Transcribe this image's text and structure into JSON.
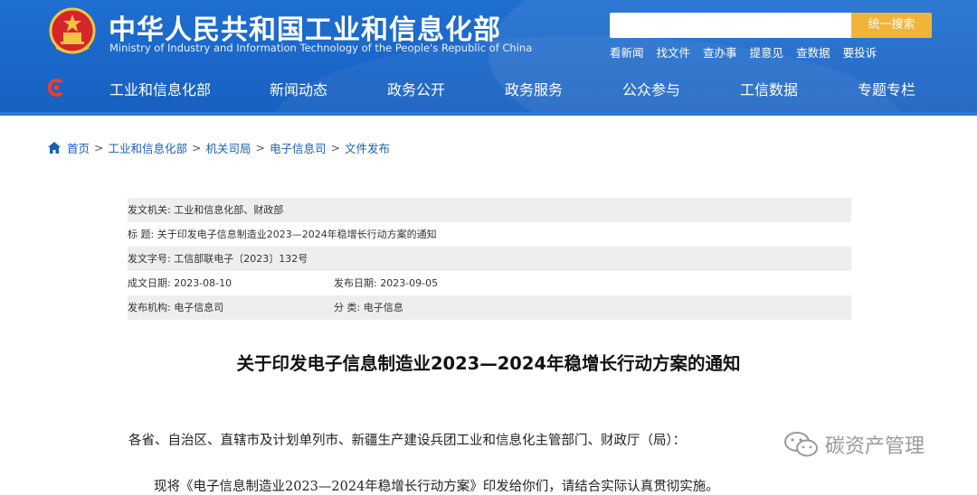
{
  "header": {
    "title_cn": "中华人民共和国工业和信息化部",
    "title_en": "Ministry of Industry and Information Technology of the People's Republic of China",
    "search": {
      "placeholder": "",
      "button_label": "统一搜索"
    },
    "quick_links": [
      "看新闻",
      "找文件",
      "查办事",
      "提意见",
      "查数据",
      "要投诉"
    ],
    "nav_items": [
      "工业和信息化部",
      "新闻动态",
      "政务公开",
      "政务服务",
      "公众参与",
      "工信数据",
      "专题专栏"
    ],
    "colors": {
      "header_blue": "#1a66c8",
      "search_button": "#f0b43a"
    }
  },
  "breadcrumb": [
    "首页",
    "工业和信息化部",
    "机关司局",
    "电子信息司",
    "文件发布"
  ],
  "meta": {
    "issuer": "发文机关:   工业和信息化部、财政部",
    "subject": "标        题:   关于印发电子信息制造业2023—2024年稳增长行动方案的通知",
    "doc_number": "发文字号:   工信部联电子〔2023〕132号",
    "created_date": "成文日期:   2023-08-10",
    "published_date": "发布日期:   2023-09-05",
    "agency": "发布机构:   电子信息司",
    "category": "分        类:   电子信息"
  },
  "document": {
    "title": "关于印发电子信息制造业2023—2024年稳增长行动方案的通知",
    "para1": "各省、自治区、直辖市及计划单列市、新疆生产建设兵团工业和信息化主管部门、财政厅（局）：",
    "para2": "现将《电子信息制造业2023—2024年稳增长行动方案》印发给你们，请结合实际认真贯彻实施。"
  },
  "watermark": {
    "text": "碳资产管理",
    "icon": "wechat-icon"
  }
}
